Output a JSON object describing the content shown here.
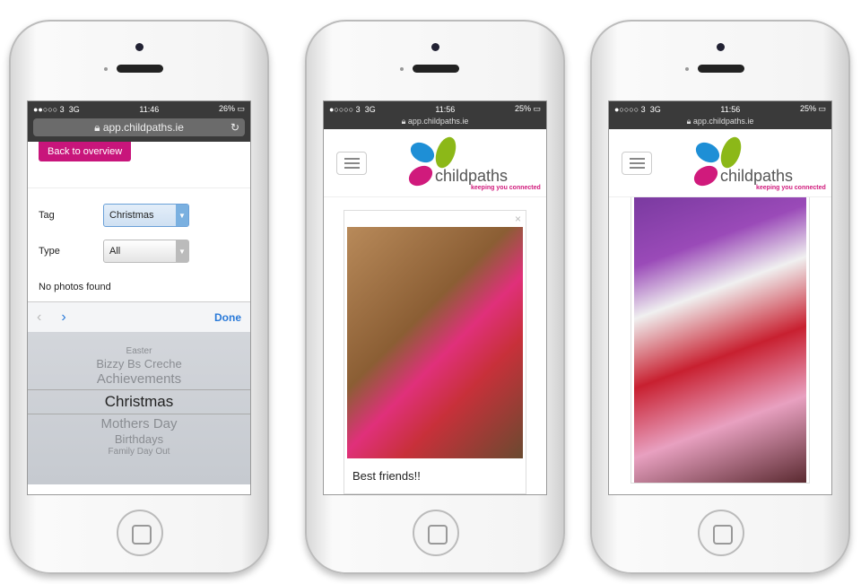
{
  "phones": [
    {
      "status": {
        "carrier": "●●○○○ 3",
        "network": "3G",
        "time": "11:46",
        "battery": "26%"
      },
      "url": "app.childpaths.ie",
      "back_label": "Back to overview",
      "filters": [
        {
          "label": "Tag",
          "value": "Christmas"
        },
        {
          "label": "Type",
          "value": "All"
        }
      ],
      "empty_message": "No photos found",
      "done_label": "Done",
      "picker_options": [
        "Easter",
        "Bizzy Bs Creche",
        "Achievements",
        "Christmas",
        "Mothers Day",
        "Birthdays",
        "Family Day Out"
      ],
      "picker_selected": "Christmas"
    },
    {
      "status": {
        "carrier": "●○○○○ 3",
        "network": "3G",
        "time": "11:56",
        "battery": "25%"
      },
      "url": "app.childpaths.ie",
      "logo": {
        "name": "childpaths",
        "tagline": "keeping you connected"
      },
      "caption": "Best friends!!"
    },
    {
      "status": {
        "carrier": "●○○○○ 3",
        "network": "3G",
        "time": "11:56",
        "battery": "25%"
      },
      "url": "app.childpaths.ie",
      "logo": {
        "name": "childpaths",
        "tagline": "keeping you connected"
      }
    }
  ],
  "colors": {
    "brand_pink": "#c8157b",
    "link_blue": "#2a7ad9"
  }
}
